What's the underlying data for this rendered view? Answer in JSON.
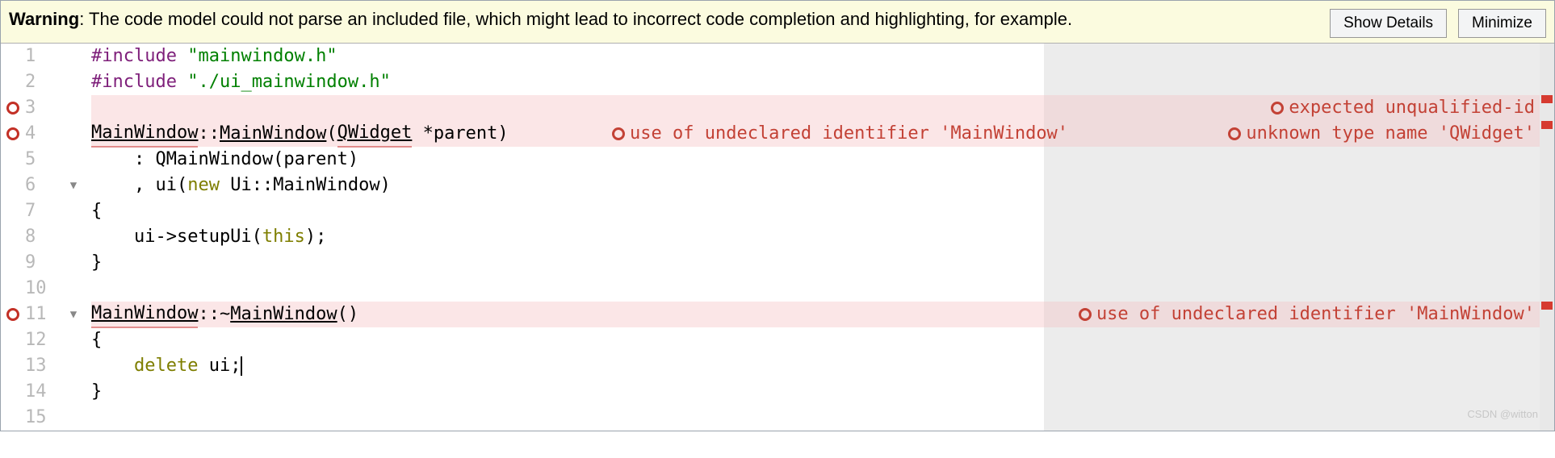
{
  "warning": {
    "label": "Warning",
    "text": ": The code model could not parse an included file, which might lead to incorrect code completion and highlighting, for example.",
    "show_details": "Show Details",
    "minimize": "Minimize"
  },
  "lines": {
    "n1": "1",
    "n2": "2",
    "n3": "3",
    "n4": "4",
    "n5": "5",
    "n6": "6",
    "n7": "7",
    "n8": "8",
    "n9": "9",
    "n10": "10",
    "n11": "11",
    "n12": "12",
    "n13": "13",
    "n14": "14",
    "n15": "15"
  },
  "fold": {
    "down6": "▼",
    "down11": "▼"
  },
  "code": {
    "l1_inc": "#include ",
    "l1_str": "\"mainwindow.h\"",
    "l2_inc": "#include ",
    "l2_str": "\"./ui_mainwindow.h\"",
    "l4_a": "MainWindow",
    "l4_b": "::",
    "l4_c": "MainWindow",
    "l4_d": "(",
    "l4_e": "QWidget",
    "l4_f": " *parent)",
    "l5": "    : QMainWindow(parent)",
    "l6_a": "    , ui(",
    "l6_b": "new",
    "l6_c": " Ui::MainWindow)",
    "l7": "{",
    "l8_a": "    ui->setupUi(",
    "l8_b": "this",
    "l8_c": ");",
    "l9": "}",
    "l11_a": "MainWindow",
    "l11_b": "::~",
    "l11_c": "MainWindow",
    "l11_d": "()",
    "l12": "{",
    "l13_a": "    ",
    "l13_b": "delete",
    "l13_c": " ui;",
    "l14": "}"
  },
  "errors": {
    "e3": "expected unqualified-id",
    "e4a": "use of undeclared identifier 'MainWindow'",
    "e4b": "unknown type name 'QWidget'",
    "e11": "use of undeclared identifier 'MainWindow'"
  },
  "watermark": "CSDN @witton"
}
